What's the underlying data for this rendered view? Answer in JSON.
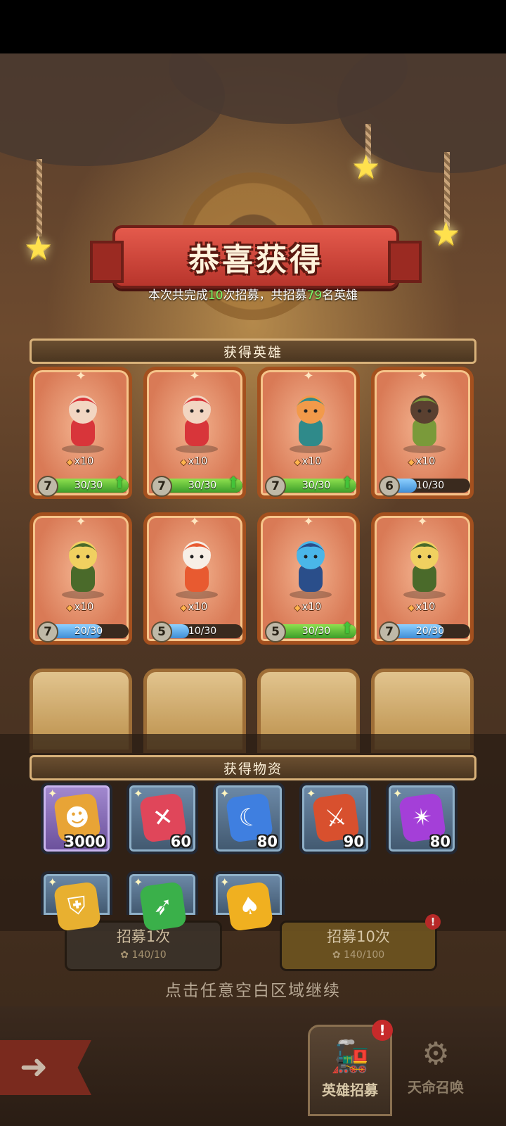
{
  "header": {
    "title": "恭喜获得",
    "summary_prefix": "本次共完成",
    "recruit_times": "10",
    "summary_middle": "次招募，共招募",
    "heroes_total": "79",
    "summary_suffix": "名英雄"
  },
  "heroes_section": {
    "title": "获得英雄",
    "cards": [
      {
        "count": "x10",
        "level": "7",
        "progress": "30/30",
        "fill": 1.0,
        "can_upgrade": true,
        "figure": "red-flower-girl"
      },
      {
        "count": "x10",
        "level": "7",
        "progress": "30/30",
        "fill": 1.0,
        "can_upgrade": true,
        "figure": "red-flower-girl"
      },
      {
        "count": "x10",
        "level": "7",
        "progress": "30/30",
        "fill": 1.0,
        "can_upgrade": true,
        "figure": "witch-cat"
      },
      {
        "count": "x10",
        "level": "6",
        "progress": "10/30",
        "fill": 0.33,
        "can_upgrade": false,
        "figure": "green-golem"
      },
      {
        "count": "x10",
        "level": "7",
        "progress": "20/30",
        "fill": 0.67,
        "can_upgrade": false,
        "figure": "hooded-rogue"
      },
      {
        "count": "x10",
        "level": "5",
        "progress": "10/30",
        "fill": 0.33,
        "can_upgrade": false,
        "figure": "bunny-girl"
      },
      {
        "count": "x10",
        "level": "5",
        "progress": "30/30",
        "fill": 1.0,
        "can_upgrade": true,
        "figure": "blue-mage"
      },
      {
        "count": "x10",
        "level": "7",
        "progress": "20/30",
        "fill": 0.67,
        "can_upgrade": false,
        "figure": "hooded-rogue"
      }
    ]
  },
  "items_section": {
    "title": "获得物资",
    "items": [
      {
        "qty": "3000",
        "icon": "coin-icon",
        "color": "#e8a436"
      },
      {
        "qty": "60",
        "icon": "cross-gem-icon",
        "color": "#e0465a"
      },
      {
        "qty": "80",
        "icon": "wizard-hat-gem-icon",
        "color": "#3f7fe0"
      },
      {
        "qty": "90",
        "icon": "sword-gem-icon",
        "color": "#d8502e"
      },
      {
        "qty": "80",
        "icon": "shuriken-gem-icon",
        "color": "#a43fd8"
      },
      {
        "qty": "",
        "icon": "shield-gem-icon",
        "color": "#e8b030"
      },
      {
        "qty": "",
        "icon": "bow-gem-icon",
        "color": "#3ab04a"
      },
      {
        "qty": "",
        "icon": "spade-coin-icon",
        "color": "#f0b020"
      }
    ]
  },
  "recruit_buttons": {
    "once_label": "招募1次",
    "once_cost": "140/10",
    "ten_label": "招募10次",
    "ten_cost": "140/100"
  },
  "continue_hint": "点击任意空白区域继续",
  "bottom_nav": {
    "hero_recruit": "英雄招募",
    "fate_summon": "天命召唤",
    "badge": "!"
  }
}
